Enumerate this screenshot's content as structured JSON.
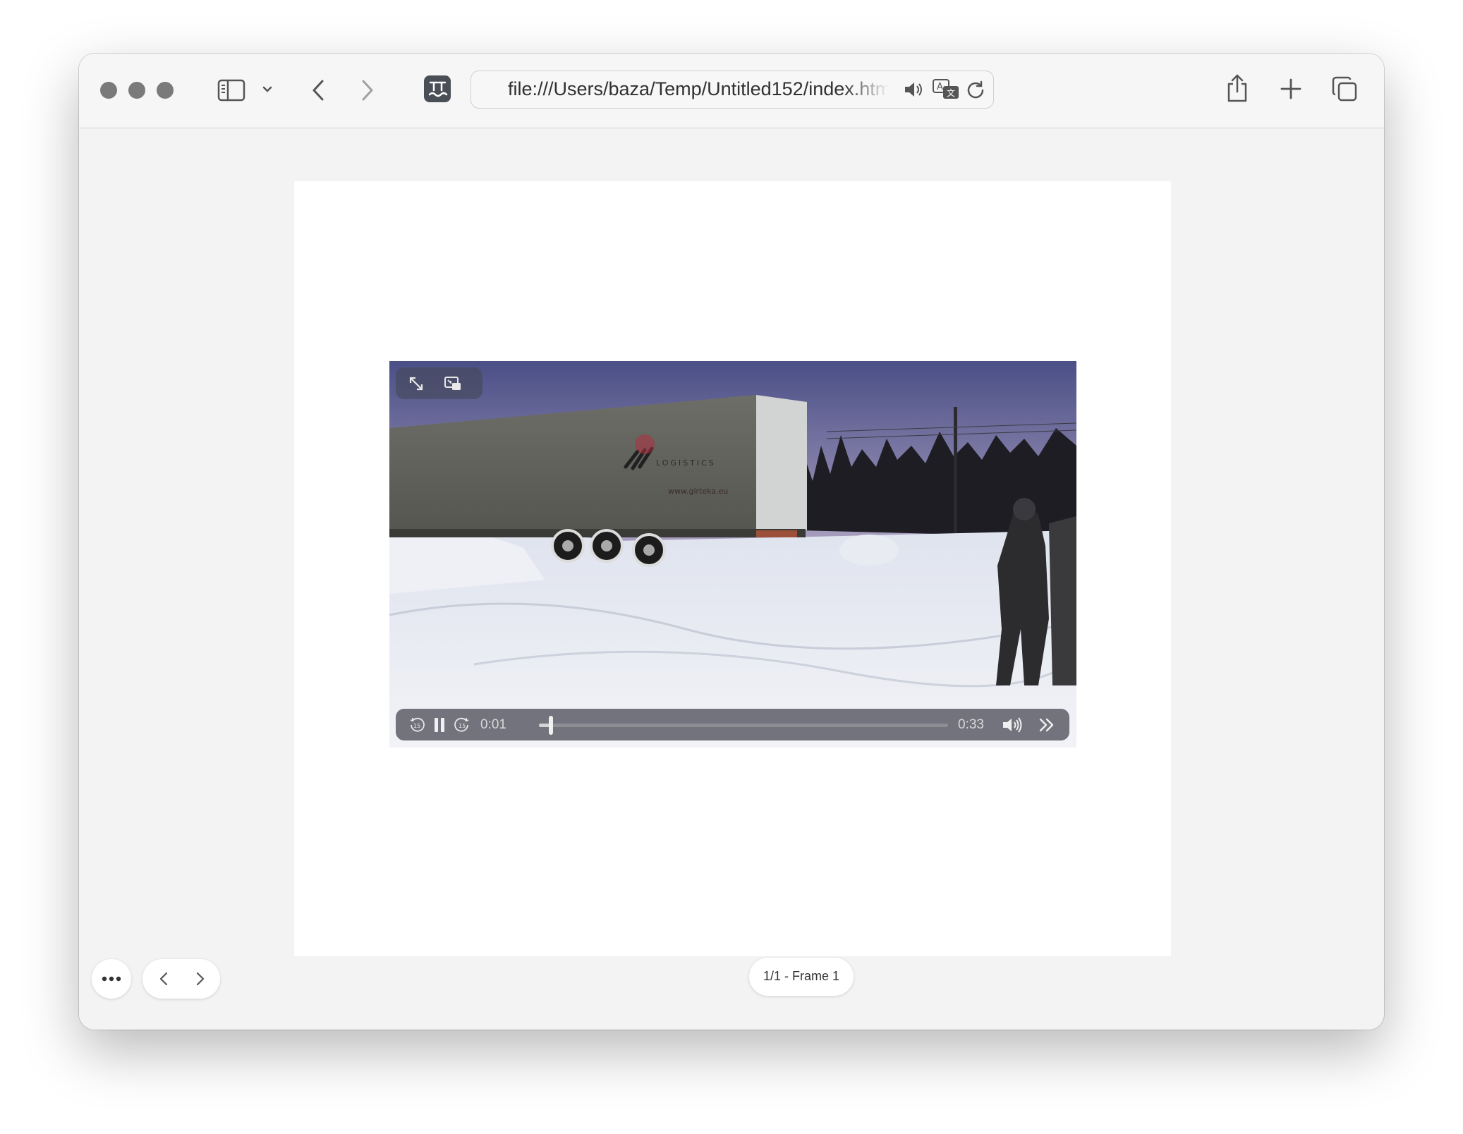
{
  "browser": {
    "url": "file:///Users/baza/Temp/Untitled152/index.html",
    "accent_traffic_light": "#7a7a7a"
  },
  "video": {
    "current_time": "0:01",
    "duration": "0:33",
    "progress_fraction": 0.03,
    "trailer_brand": "LOGISTICS",
    "trailer_url": "www.girteka.eu"
  },
  "bottom_bar": {
    "frame_label": "1/1 - Frame 1"
  }
}
